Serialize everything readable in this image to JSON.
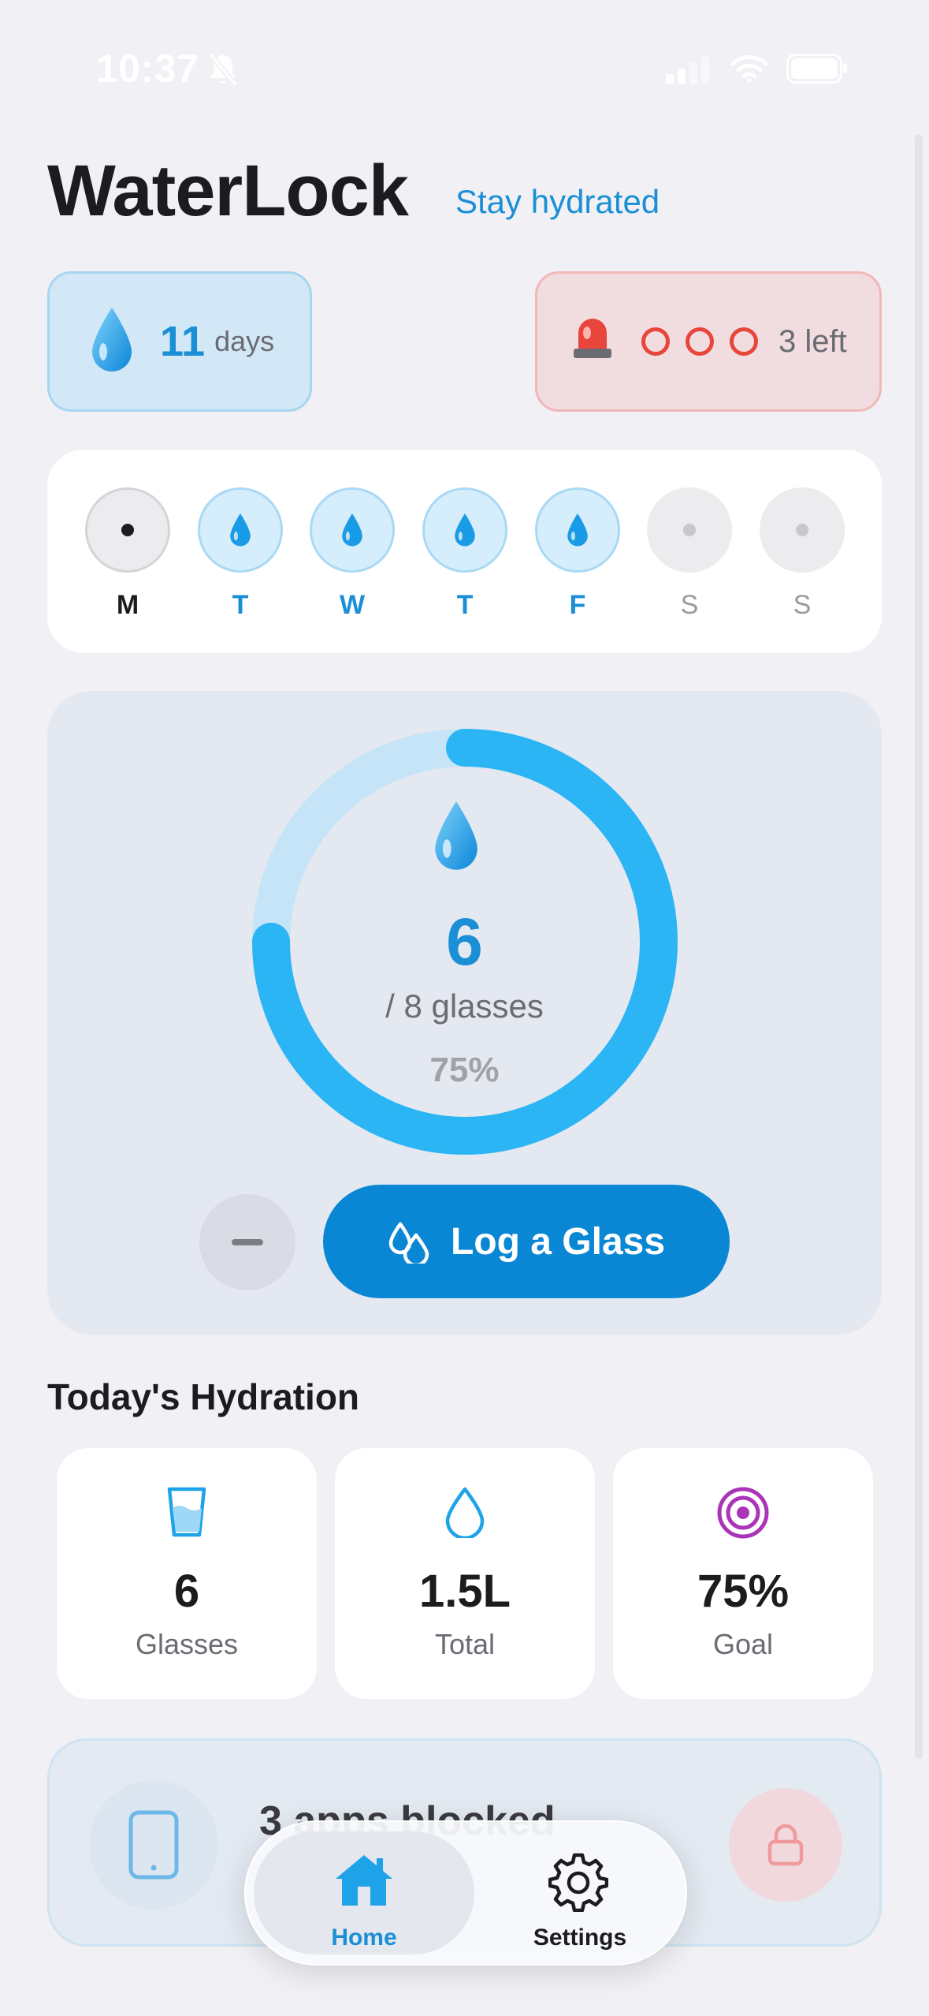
{
  "status_bar": {
    "time": "10:37"
  },
  "header": {
    "title": "WaterLock",
    "subtitle": "Stay hydrated"
  },
  "streak": {
    "value": "11",
    "unit": "days"
  },
  "emergency": {
    "remaining_label": "3 left",
    "unlocks_total": 3
  },
  "week": {
    "days": [
      {
        "label": "M",
        "state": "today"
      },
      {
        "label": "T",
        "state": "done"
      },
      {
        "label": "W",
        "state": "done"
      },
      {
        "label": "T",
        "state": "done"
      },
      {
        "label": "F",
        "state": "done"
      },
      {
        "label": "S",
        "state": "future"
      },
      {
        "label": "S",
        "state": "future"
      }
    ]
  },
  "progress": {
    "count": "6",
    "goal_label": "/ 8 glasses",
    "percent_label": "75%",
    "fraction": 0.75,
    "log_button_label": "Log a Glass"
  },
  "hydration": {
    "title": "Today's Hydration",
    "stats": [
      {
        "value": "6",
        "label": "Glasses",
        "icon": "glass-icon"
      },
      {
        "value": "1.5L",
        "label": "Total",
        "icon": "drop-outline-icon"
      },
      {
        "value": "75%",
        "label": "Goal",
        "icon": "target-icon"
      }
    ]
  },
  "blocked": {
    "title": "3 apps blocked"
  },
  "tabs": {
    "home": "Home",
    "settings": "Settings"
  },
  "colors": {
    "accent": "#1a8fd6",
    "button": "#0a87d4",
    "ring": "#2bb5f5",
    "ring_track": "#c6e4f7",
    "danger": "#e8453c",
    "target": "#a934b8"
  }
}
